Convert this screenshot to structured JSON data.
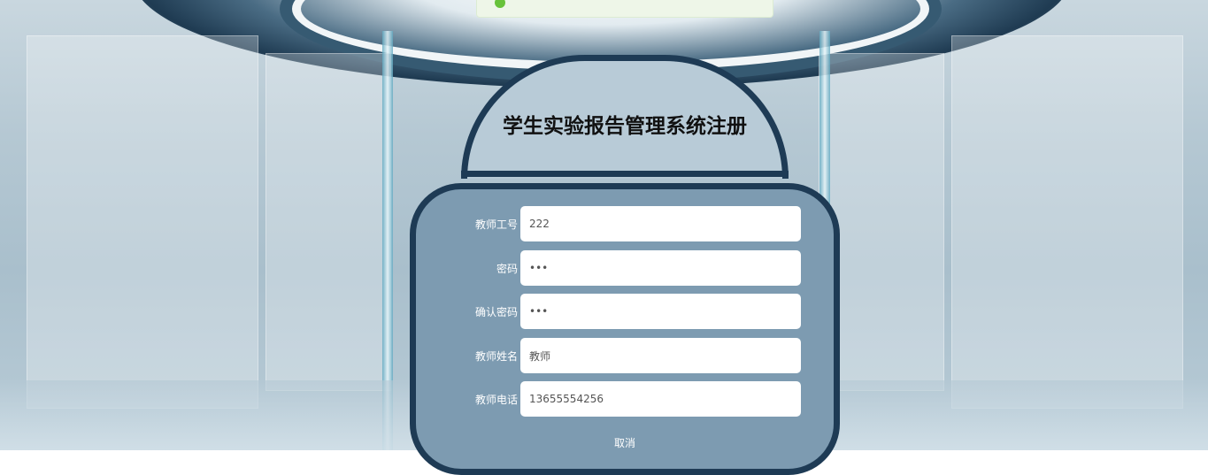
{
  "header": {
    "title": "学生实验报告管理系统注册"
  },
  "toast": {
    "icon": "success-check-icon",
    "color": "#67c23a"
  },
  "form": {
    "fields": [
      {
        "label": "教师工号",
        "value": "222",
        "type": "text"
      },
      {
        "label": "密码",
        "value": "...",
        "type": "password"
      },
      {
        "label": "确认密码",
        "value": "...",
        "type": "password"
      },
      {
        "label": "教师姓名",
        "value": "教师",
        "type": "text"
      },
      {
        "label": "教师电话",
        "value": "13655554256",
        "type": "text"
      }
    ],
    "cancel_label": "取消"
  },
  "colors": {
    "panel_border": "#1e3b55",
    "panel_bg": "#7d9bb1",
    "dome_bg": "#b8cbd7"
  }
}
